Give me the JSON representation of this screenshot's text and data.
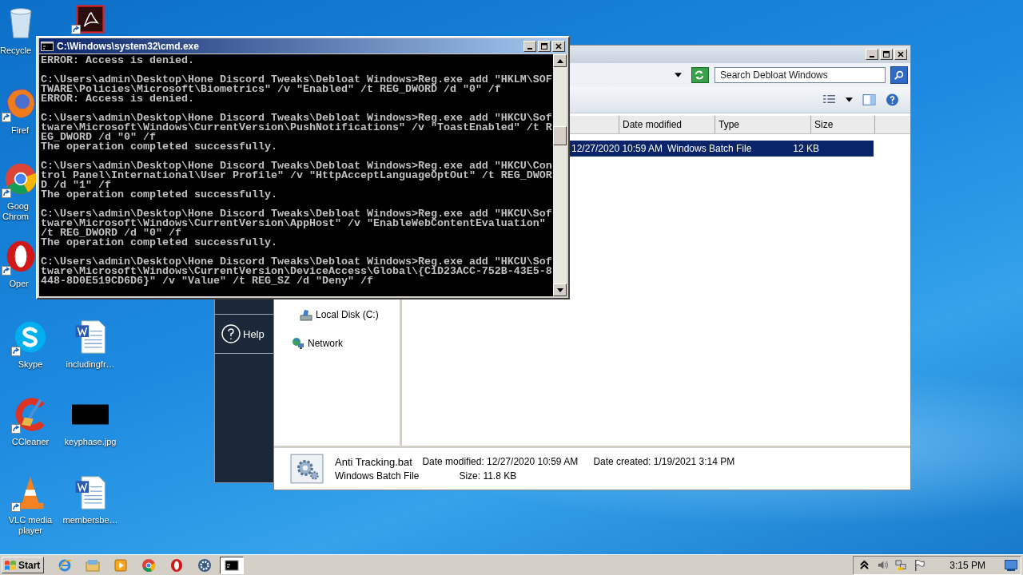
{
  "desktop_icons": [
    {
      "kind": "recycle",
      "label": "Recycle",
      "shortcut": false
    },
    {
      "kind": "acrobat",
      "shortcut": true
    },
    {
      "kind": "firefox",
      "label": "Firef",
      "shortcut": true
    },
    {
      "kind": "chrome",
      "label": "Goog Chrom",
      "shortcut": true
    },
    {
      "kind": "opera",
      "label": "Oper",
      "shortcut": true
    },
    {
      "kind": "skype",
      "label": "Skype",
      "shortcut": true
    },
    {
      "kind": "word",
      "label": "includingfr…",
      "shortcut": false
    },
    {
      "kind": "ccleaner",
      "label": "CCleaner",
      "shortcut": true
    },
    {
      "kind": "image",
      "label": "keyphase.jpg",
      "shortcut": false
    },
    {
      "kind": "vlc",
      "label": "VLC media player",
      "shortcut": true
    },
    {
      "kind": "word",
      "label": "membersbe…",
      "shortcut": false
    }
  ],
  "side_app": {
    "help": "Help"
  },
  "explorer": {
    "search": {
      "placeholder": "Search Debloat Windows"
    },
    "columns": [
      "Date modified",
      "Type",
      "Size"
    ],
    "rows": [
      {
        "date": "12/27/2020 10:59 AM",
        "type": "Windows Batch File",
        "size": "12 KB",
        "selected": true
      }
    ],
    "nav": [
      {
        "kind": "disk",
        "label": "Local Disk (C:)"
      },
      {
        "kind": "network",
        "label": "Network"
      }
    ],
    "details": {
      "name": "Anti Tracking.bat",
      "date_modified": "Date modified: 12/27/2020 10:59 AM",
      "date_created": "Date created: 1/19/2021 3:14 PM",
      "type": "Windows Batch File",
      "size": "Size: 11.8 KB"
    }
  },
  "cmd": {
    "title": "C:\\Windows\\system32\\cmd.exe",
    "blocks": [
      [
        "ERROR: Access is denied."
      ],
      [
        "C:\\Users\\admin\\Desktop\\Hone Discord Tweaks\\Debloat Windows>Reg.exe add \"HKLM\\SOF",
        "TWARE\\Policies\\Microsoft\\Biometrics\" /v \"Enabled\" /t REG_DWORD /d \"0\" /f",
        "ERROR: Access is denied."
      ],
      [
        "C:\\Users\\admin\\Desktop\\Hone Discord Tweaks\\Debloat Windows>Reg.exe add \"HKCU\\Sof",
        "tware\\Microsoft\\Windows\\CurrentVersion\\PushNotifications\" /v \"ToastEnabled\" /t R",
        "EG_DWORD /d \"0\" /f",
        "The operation completed successfully."
      ],
      [
        "C:\\Users\\admin\\Desktop\\Hone Discord Tweaks\\Debloat Windows>Reg.exe add \"HKCU\\Con",
        "trol Panel\\International\\User Profile\" /v \"HttpAcceptLanguageOptOut\" /t REG_DWOR",
        "D /d \"1\" /f",
        "The operation completed successfully."
      ],
      [
        "C:\\Users\\admin\\Desktop\\Hone Discord Tweaks\\Debloat Windows>Reg.exe add \"HKCU\\Sof",
        "tware\\Microsoft\\Windows\\CurrentVersion\\AppHost\" /v \"EnableWebContentEvaluation\"",
        "/t REG_DWORD /d \"0\" /f",
        "The operation completed successfully."
      ],
      [
        "C:\\Users\\admin\\Desktop\\Hone Discord Tweaks\\Debloat Windows>Reg.exe add \"HKCU\\Sof",
        "tware\\Microsoft\\Windows\\CurrentVersion\\DeviceAccess\\Global\\{C1D23ACC-752B-43E5-8",
        "448-8D0E519CD6D6}\" /v \"Value\" /t REG_SZ /d \"Deny\" /f"
      ]
    ]
  },
  "taskbar": {
    "start": "Start",
    "apps": [
      {
        "kind": "ie",
        "active": false
      },
      {
        "kind": "folder",
        "active": false
      },
      {
        "kind": "media",
        "active": false
      },
      {
        "kind": "chrome",
        "active": false
      },
      {
        "kind": "opera",
        "active": false
      },
      {
        "kind": "gear",
        "active": false
      },
      {
        "kind": "cmd",
        "active": true
      }
    ],
    "clock": "3:15 PM"
  }
}
